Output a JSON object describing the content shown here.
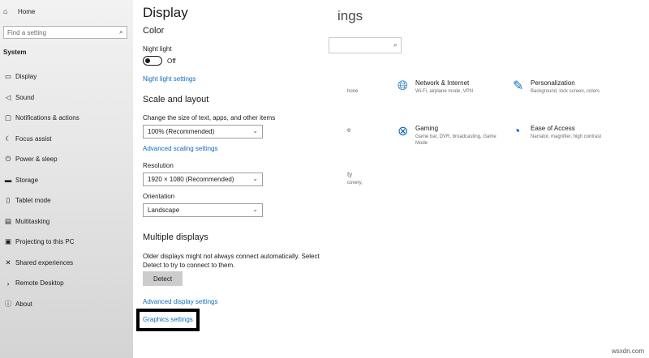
{
  "sidebar": {
    "home_label": "Home",
    "search_placeholder": "Find a setting",
    "section_label": "System",
    "items": [
      {
        "label": "Display",
        "icon": "display-icon"
      },
      {
        "label": "Sound",
        "icon": "sound-icon"
      },
      {
        "label": "Notifications & actions",
        "icon": "notifications-icon"
      },
      {
        "label": "Focus assist",
        "icon": "focus-assist-icon"
      },
      {
        "label": "Power & sleep",
        "icon": "power-icon"
      },
      {
        "label": "Storage",
        "icon": "storage-icon"
      },
      {
        "label": "Tablet mode",
        "icon": "tablet-icon"
      },
      {
        "label": "Multitasking",
        "icon": "multitasking-icon"
      },
      {
        "label": "Projecting to this PC",
        "icon": "projecting-icon"
      },
      {
        "label": "Shared experiences",
        "icon": "shared-experiences-icon"
      },
      {
        "label": "Remote Desktop",
        "icon": "remote-desktop-icon"
      },
      {
        "label": "About",
        "icon": "about-icon"
      }
    ]
  },
  "display": {
    "title": "Display",
    "color_heading": "Color",
    "night_light_label": "Night light",
    "night_light_state": "Off",
    "night_light_settings_link": "Night light settings",
    "scale_heading": "Scale and layout",
    "scale_label": "Change the size of text, apps, and other items",
    "scale_value": "100% (Recommended)",
    "advanced_scaling_link": "Advanced scaling settings",
    "resolution_label": "Resolution",
    "resolution_value": "1920 × 1080 (Recommended)",
    "orientation_label": "Orientation",
    "orientation_value": "Landscape",
    "multiple_heading": "Multiple displays",
    "multiple_text": "Older displays might not always connect automatically. Select Detect to try to connect to them.",
    "detect_button": "Detect",
    "advanced_display_link": "Advanced display settings",
    "graphics_link": "Graphics settings"
  },
  "background_window": {
    "title_fragment": "ings",
    "fragments": [
      "hone",
      "e",
      "ty",
      "covery, "
    ],
    "tiles": [
      {
        "title": "Network & Internet",
        "desc": "Wi-Fi, airplane mode, VPN",
        "icon": "globe-icon"
      },
      {
        "title": "Personalization",
        "desc": "Background, lock screen, colors",
        "icon": "personalization-icon"
      },
      {
        "title": "Gaming",
        "desc": "Game bar, DVR, broadcasting, Game Mode",
        "icon": "xbox-icon"
      },
      {
        "title": "Ease of Access",
        "desc": "Narrator, magnifier, high contrast",
        "icon": "ease-of-access-icon"
      }
    ]
  },
  "watermark": "wsxdn.com",
  "colors": {
    "accent": "#0f6cbd",
    "highlight_border": "#000000"
  }
}
